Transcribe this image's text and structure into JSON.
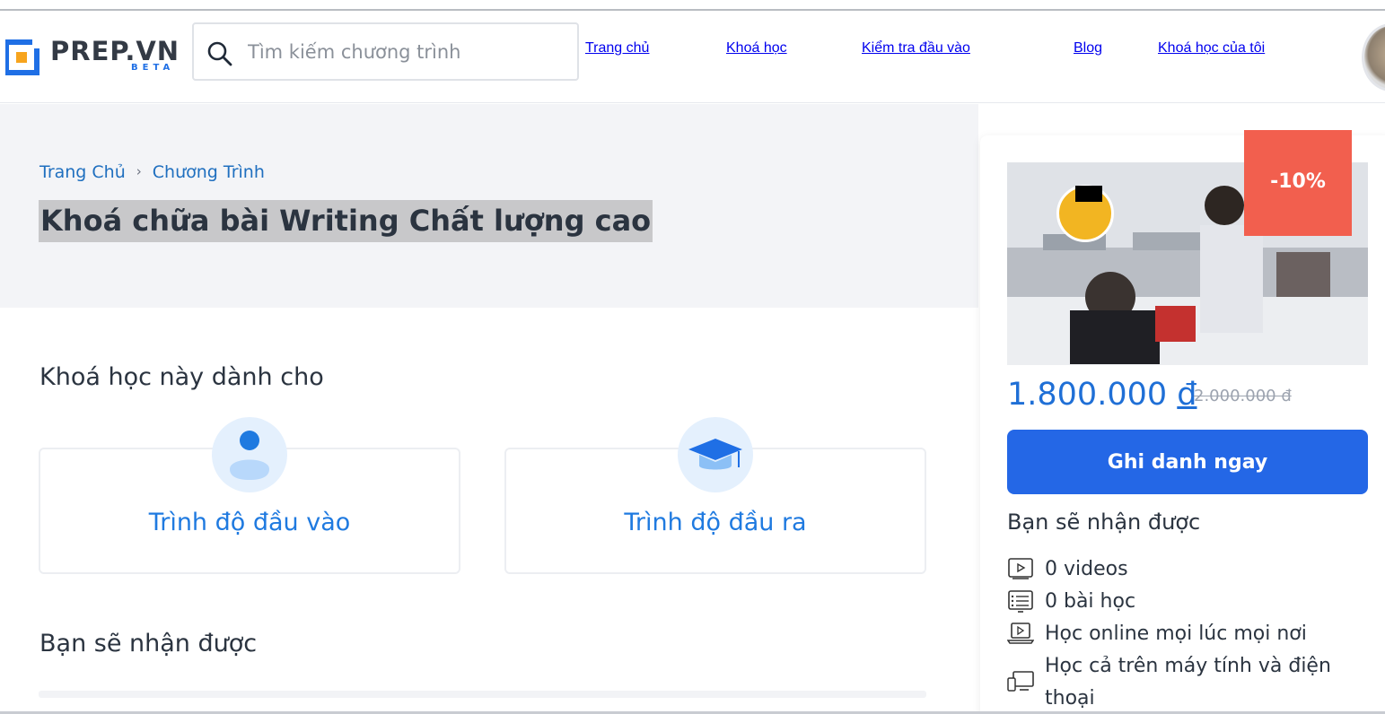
{
  "header": {
    "logo_text": "PREP.VN",
    "logo_sub": "BETA",
    "search_placeholder": "Tìm kiếm chương trình",
    "nav": [
      {
        "label": "Trang chủ"
      },
      {
        "label": "Khoá học"
      },
      {
        "label": "Kiểm tra đầu vào"
      },
      {
        "label": "Blog"
      },
      {
        "label": "Khoá học của tôi"
      }
    ]
  },
  "breadcrumb": {
    "items": [
      "Trang Chủ",
      "Chương Trình"
    ],
    "separator": "›"
  },
  "page_title": "Khoá chữa bài Writing Chất lượng cao",
  "audience": {
    "heading": "Khoá học này dành cho",
    "cards": [
      {
        "label": "Trình độ đầu vào",
        "icon": "user-icon"
      },
      {
        "label": "Trình độ đầu ra",
        "icon": "graduation-cap-icon"
      }
    ]
  },
  "benefits_heading": "Bạn sẽ nhận được",
  "sidebar": {
    "discount_badge": "-10%",
    "price": "1.800.000",
    "currency": "đ",
    "old_price": "2.000.000 đ",
    "enroll_label": "Ghi danh ngay",
    "receive_heading": "Bạn sẽ nhận được",
    "features": [
      {
        "text": "0 videos",
        "icon": "video-icon"
      },
      {
        "text": "0 bài học",
        "icon": "lesson-list-icon"
      },
      {
        "text": "Học online mọi lúc mọi nơi",
        "icon": "laptop-play-icon"
      },
      {
        "text": "Học cả trên máy tính và điện thoại",
        "icon": "devices-icon"
      }
    ]
  },
  "colors": {
    "brand_blue": "#2467e6",
    "link_blue": "#1f7ae0",
    "sale_red": "#f25f4e",
    "hero_bg": "#f3f4f7"
  }
}
